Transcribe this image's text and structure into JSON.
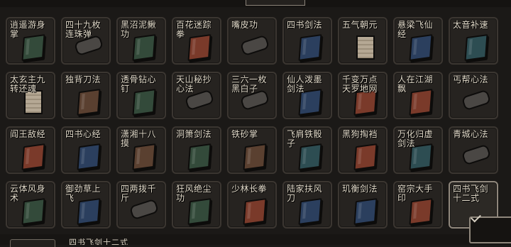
{
  "colors": {
    "book_red": "#7a3a2a",
    "book_blue": "#2b3f5e",
    "book_green": "#334a3a",
    "book_brown": "#5a4030",
    "book_teal": "#2d4d52",
    "scroll_gray": "#4a4744",
    "paper_tan": "#b5a894"
  },
  "skills": [
    {
      "name": "逍遥游身掌",
      "icon": "book-icon",
      "color": "#334a3a"
    },
    {
      "name": "四十九枚连珠弹",
      "icon": "scroll-icon",
      "color": "#4a4744"
    },
    {
      "name": "黑沼泥鳅功",
      "icon": "book-icon",
      "color": "#334a3a"
    },
    {
      "name": "百花迷踪拳",
      "icon": "book-icon",
      "color": "#7a3a2a"
    },
    {
      "name": "嘴皮功",
      "icon": "scroll-icon",
      "color": "#4a4744"
    },
    {
      "name": "四书剑法",
      "icon": "book-icon",
      "color": "#2b3f5e"
    },
    {
      "name": "五气朝元",
      "icon": "paper-icon",
      "color": "#b5a894"
    },
    {
      "name": "悬梁飞仙经",
      "icon": "book-icon",
      "color": "#2b3f5e"
    },
    {
      "name": "太音补速",
      "icon": "book-icon",
      "color": "#2d4d52"
    },
    {
      "name": "太玄主九转还魂",
      "icon": "paper-icon",
      "color": "#b5a894"
    },
    {
      "name": "独背刀法",
      "icon": "book-icon",
      "color": "#5a4030"
    },
    {
      "name": "透骨钻心钉",
      "icon": "book-icon",
      "color": "#334a3a"
    },
    {
      "name": "天山秘抄心法",
      "icon": "scroll-icon",
      "color": "#4a4744"
    },
    {
      "name": "三六一枚黑白子",
      "icon": "scroll-icon",
      "color": "#4a4744"
    },
    {
      "name": "仙人泼墨剑法",
      "icon": "book-icon",
      "color": "#2b3f5e"
    },
    {
      "name": "千变万点天罗地网",
      "icon": "book-icon",
      "color": "#7a3a2a"
    },
    {
      "name": "人在江湖飘",
      "icon": "book-icon",
      "color": "#7a3a2a"
    },
    {
      "name": "丐帮心法",
      "icon": "scroll-icon",
      "color": "#4a4744"
    },
    {
      "name": "阎王敌经",
      "icon": "book-icon",
      "color": "#7a3a2a"
    },
    {
      "name": "四书心经",
      "icon": "book-icon",
      "color": "#2b3f5e"
    },
    {
      "name": "潇湘十八摸",
      "icon": "book-icon",
      "color": "#5a4030"
    },
    {
      "name": "洞箫剑法",
      "icon": "book-icon",
      "color": "#334a3a"
    },
    {
      "name": "铁砂掌",
      "icon": "book-icon",
      "color": "#5a4030"
    },
    {
      "name": "飞肩铁骰子",
      "icon": "book-icon",
      "color": "#2d4d52"
    },
    {
      "name": "黑狗掏裆",
      "icon": "book-icon",
      "color": "#7a3a2a"
    },
    {
      "name": "万化归虚剑法",
      "icon": "book-icon",
      "color": "#2d4d52"
    },
    {
      "name": "青城心法",
      "icon": "scroll-icon",
      "color": "#4a4744"
    },
    {
      "name": "云体风身术",
      "icon": "book-icon",
      "color": "#334a3a"
    },
    {
      "name": "御劲草上飞",
      "icon": "book-icon",
      "color": "#2b3f5e"
    },
    {
      "name": "四两拨千斤",
      "icon": "scroll-icon",
      "color": "#4a4744"
    },
    {
      "name": "狂风绝尘功",
      "icon": "book-icon",
      "color": "#334a3a"
    },
    {
      "name": "少林长拳",
      "icon": "book-icon",
      "color": "#7a3a2a"
    },
    {
      "name": "陆家扶风刀",
      "icon": "book-icon",
      "color": "#2b3f5e"
    },
    {
      "name": "玑衡剑法",
      "icon": "book-icon",
      "color": "#2b3f5e"
    },
    {
      "name": "窑宗大手印",
      "icon": "book-icon",
      "color": "#7a3a2a"
    },
    {
      "name": "四书飞剑十二式",
      "icon": "check-icon",
      "color": "#2c2925",
      "selected": true
    }
  ],
  "bottom": {
    "text": "四书飞剑十二式"
  }
}
